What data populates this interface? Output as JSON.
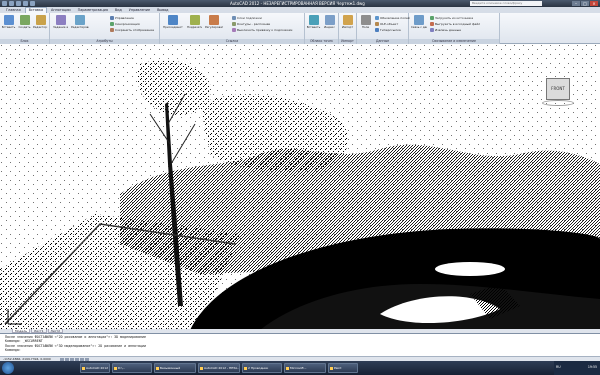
{
  "window": {
    "title": "AutoCAD 2012 - НЕЗАРЕГИСТРИРОВАННАЯ ВЕРСИЯ  Чертеж1.dwg",
    "search_placeholder": "Введите ключевое слово/фразу"
  },
  "ribbon_tabs": [
    "Главная",
    "Вставка",
    "Аннотации",
    "Параметризация",
    "Вид",
    "Управление",
    "Вывод"
  ],
  "active_tab_index": 1,
  "panels": [
    {
      "title": "Блок",
      "buttons": [
        "Вставить",
        "Создать",
        "Редактор блоков"
      ]
    },
    {
      "title": "Атрибуты",
      "buttons": [
        "Задание атрибутов",
        "Редактировать атрибут"
      ],
      "items": [
        "Управление",
        "Синхронизация",
        "Сохранить отображение"
      ]
    },
    {
      "title": "Ссылка",
      "buttons": [
        "Присоединить",
        "Подрезать",
        "Регулировать"
      ],
      "items": [
        "Слои подложки",
        "Контуры - распознав",
        "Выключить привязку к подложкам"
      ]
    },
    {
      "title": "Облако точек",
      "buttons": [
        "Вставить",
        "Индекс"
      ]
    },
    {
      "title": "Импорт",
      "buttons": [
        "Импорт"
      ]
    },
    {
      "title": "Данные",
      "buttons": [
        "Поле"
      ],
      "items": [
        "Обновление полей",
        "OLE-объект",
        "Гиперссылка"
      ]
    },
    {
      "title": "Связывание и извлечение",
      "buttons": [
        "Связь с данными"
      ],
      "items": [
        "Загрузить из источника",
        "Выгрузить в исходный файл",
        "Извлечь данные"
      ]
    }
  ],
  "viewcube": {
    "label": "FRONT"
  },
  "layout_tabs": [
    "Модель",
    "Лист1",
    "Лист2"
  ],
  "active_layout_index": 0,
  "command_history": [
    "После значения ФОСТАВИЛИ <\"2D рисование и аннотации\">: 3D моделирование",
    "Команда: _WSCURRENT",
    "После значения ФОСТАВИЛИ <\"3D моделирование\">: 2D рисование и аннотации",
    "Команда:"
  ],
  "status": {
    "coordinates": "-1152.4866, 2199.7394, 0.0000"
  },
  "taskbar": {
    "items": [
      "AutoCAD 2012",
      "D:\\...",
      "Безымянный",
      "AutoCAD 2012 - НЕЗА...",
      "2 Проводник",
      "Microsoft...",
      "Paint"
    ],
    "language": "RU",
    "clock": "19:55"
  },
  "colors": {
    "ribbon_bg": "#e6ebf2",
    "titlebar": "#3a4658",
    "viewport_bg": "#ffffff"
  }
}
